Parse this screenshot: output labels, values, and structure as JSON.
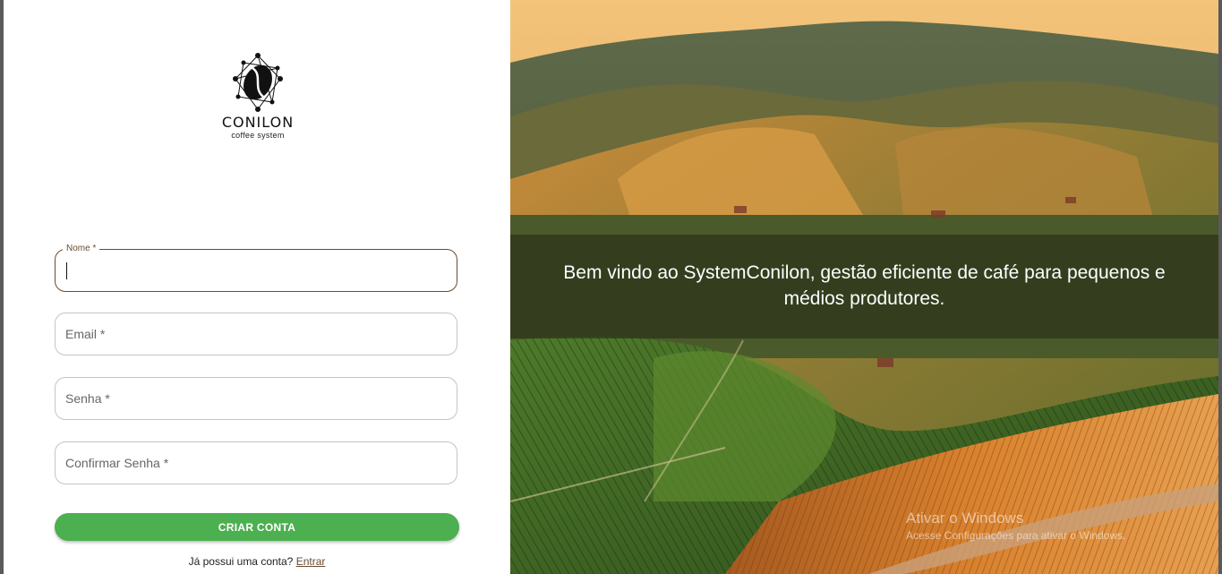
{
  "brand": {
    "name": "CONILON",
    "tagline": "coffee system",
    "icon": "coffee-bean-logo-icon"
  },
  "form": {
    "name": {
      "label": "Nome *",
      "value": ""
    },
    "email": {
      "label": "Email *"
    },
    "password": {
      "label": "Senha *"
    },
    "confirm_password": {
      "label": "Confirmar Senha *"
    },
    "submit_label": "CRIAR CONTA",
    "login_prompt": "Já possui uma conta?",
    "login_link": "Entrar"
  },
  "hero": {
    "welcome": "Bem vindo ao SystemConilon, gestão eficiente de café para pequenos e médios produtores."
  },
  "windows_watermark": {
    "title": "Ativar o Windows",
    "subtitle": "Acesse Configurações para ativar o Windows."
  },
  "colors": {
    "accent_brown": "#6b4a2e",
    "button_green": "#4caf50"
  }
}
